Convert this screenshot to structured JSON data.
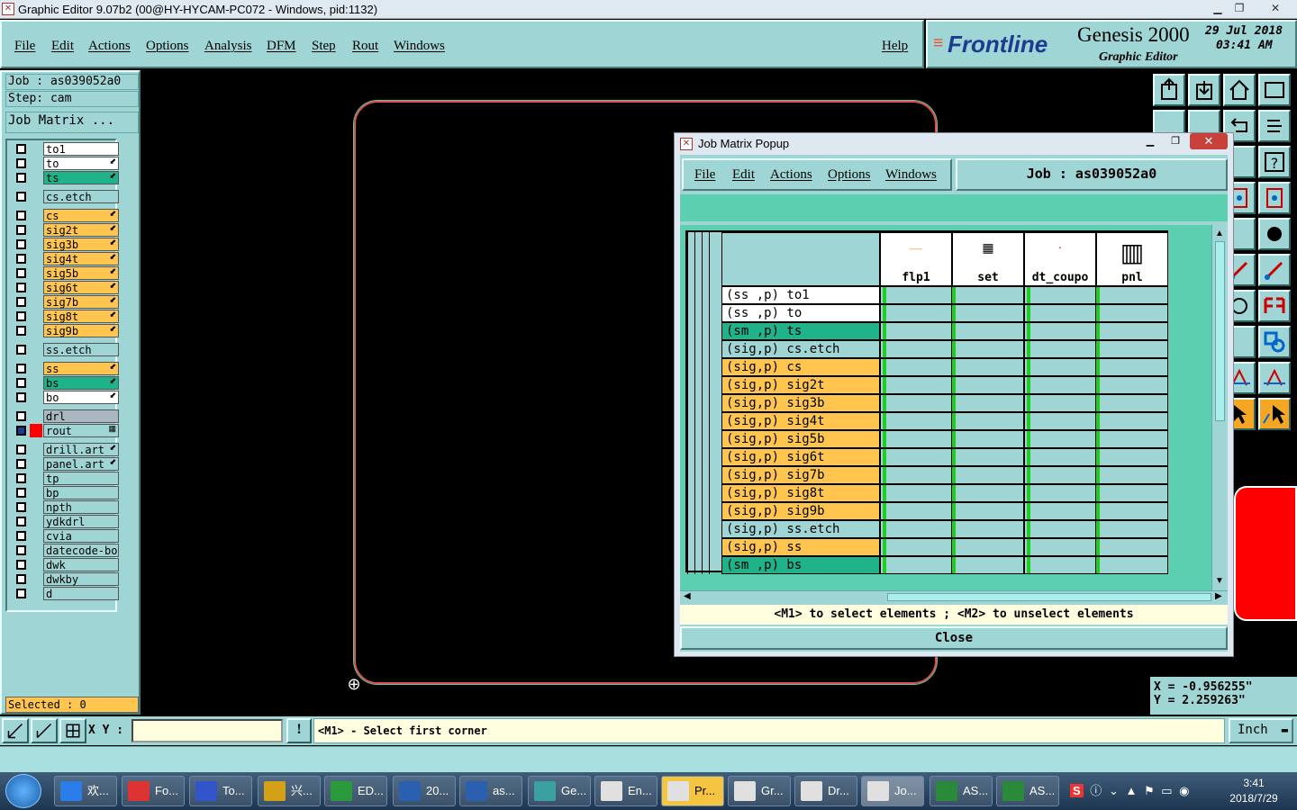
{
  "window": {
    "title": "Graphic Editor 9.07b2 (00@HY-HYCAM-PC072 - Windows, pid:1132)"
  },
  "menu": {
    "file": "File",
    "edit": "Edit",
    "actions": "Actions",
    "options": "Options",
    "analysis": "Analysis",
    "dfm": "DFM",
    "step": "Step",
    "rout": "Rout",
    "windows": "Windows",
    "help": "Help"
  },
  "brand": {
    "logo": "Frontline",
    "product": "Genesis 2000",
    "subtitle": "Graphic Editor",
    "date": "29 Jul 2018",
    "time": "03:41 AM"
  },
  "left": {
    "job": "Job : as039052a0",
    "step": "Step: cam",
    "job_matrix": "Job Matrix ...",
    "selected": "Selected : 0",
    "layers": [
      {
        "name": "to1",
        "color": "#ffffff",
        "mark": ""
      },
      {
        "name": "to",
        "color": "#ffffff",
        "mark": "⬋"
      },
      {
        "name": "ts",
        "color": "#20b38a",
        "mark": "⬋"
      },
      {
        "name": "cs.etch",
        "color": "#9fd5d5",
        "mark": ""
      },
      {
        "name": "cs",
        "color": "#ffc54f",
        "mark": "⬋"
      },
      {
        "name": "sig2t",
        "color": "#ffc54f",
        "mark": "⬋"
      },
      {
        "name": "sig3b",
        "color": "#ffc54f",
        "mark": "⬋"
      },
      {
        "name": "sig4t",
        "color": "#ffc54f",
        "mark": "⬋"
      },
      {
        "name": "sig5b",
        "color": "#ffc54f",
        "mark": "⬋"
      },
      {
        "name": "sig6t",
        "color": "#ffc54f",
        "mark": "⬋"
      },
      {
        "name": "sig7b",
        "color": "#ffc54f",
        "mark": "⬋"
      },
      {
        "name": "sig8t",
        "color": "#ffc54f",
        "mark": "⬋"
      },
      {
        "name": "sig9b",
        "color": "#ffc54f",
        "mark": "⬋"
      },
      {
        "name": "ss.etch",
        "color": "#9fd5d5",
        "mark": ""
      },
      {
        "name": "ss",
        "color": "#ffc54f",
        "mark": "⬋"
      },
      {
        "name": "bs",
        "color": "#20b38a",
        "mark": "⬋"
      },
      {
        "name": "bo",
        "color": "#ffffff",
        "mark": "⬋"
      },
      {
        "name": "drl",
        "color": "#a9b8c0",
        "mark": ""
      },
      {
        "name": "rout",
        "color": "#9fd5d5",
        "mark": "▦"
      },
      {
        "name": "drill.art",
        "color": "#9fd5d5",
        "mark": "⬋"
      },
      {
        "name": "panel.art",
        "color": "#9fd5d5",
        "mark": "⬋"
      },
      {
        "name": "tp",
        "color": "#9fd5d5",
        "mark": ""
      },
      {
        "name": "bp",
        "color": "#9fd5d5",
        "mark": ""
      },
      {
        "name": "npth",
        "color": "#9fd5d5",
        "mark": ""
      },
      {
        "name": "ydkdrl",
        "color": "#9fd5d5",
        "mark": ""
      },
      {
        "name": "cvia",
        "color": "#9fd5d5",
        "mark": ""
      },
      {
        "name": "datecode-bo",
        "color": "#9fd5d5",
        "mark": ""
      },
      {
        "name": "dwk",
        "color": "#9fd5d5",
        "mark": ""
      },
      {
        "name": "dwkby",
        "color": "#9fd5d5",
        "mark": ""
      },
      {
        "name": "d",
        "color": "#9fd5d5",
        "mark": ""
      }
    ]
  },
  "popup": {
    "title": "Job Matrix Popup",
    "menu": {
      "file": "File",
      "edit": "Edit",
      "actions": "Actions",
      "options": "Options",
      "windows": "Windows"
    },
    "job": "Job  :  as039052a0",
    "columns": [
      "flp1",
      "set",
      "dt_coupo",
      "pnl"
    ],
    "rows": [
      {
        "label": "(ss ,p) to1",
        "color": "#ffffff"
      },
      {
        "label": "(ss ,p) to",
        "color": "#ffffff"
      },
      {
        "label": "(sm ,p) ts",
        "color": "#20b38a"
      },
      {
        "label": "(sig,p) cs.etch",
        "color": "#9fd5d5"
      },
      {
        "label": "(sig,p) cs",
        "color": "#ffc54f"
      },
      {
        "label": "(sig,p) sig2t",
        "color": "#ffc54f"
      },
      {
        "label": "(sig,p) sig3b",
        "color": "#ffc54f"
      },
      {
        "label": "(sig,p) sig4t",
        "color": "#ffc54f"
      },
      {
        "label": "(sig,p) sig5b",
        "color": "#ffc54f"
      },
      {
        "label": "(sig,p) sig6t",
        "color": "#ffc54f"
      },
      {
        "label": "(sig,p) sig7b",
        "color": "#ffc54f"
      },
      {
        "label": "(sig,p) sig8t",
        "color": "#ffc54f"
      },
      {
        "label": "(sig,p) sig9b",
        "color": "#ffc54f"
      },
      {
        "label": "(sig,p) ss.etch",
        "color": "#9fd5d5"
      },
      {
        "label": "(sig,p) ss",
        "color": "#ffc54f"
      },
      {
        "label": "(sm ,p) bs",
        "color": "#20b38a"
      }
    ],
    "hint": "<M1> to select elements ; <M2> to unselect elements",
    "close": "Close"
  },
  "coords": {
    "x": "X = -0.956255\"",
    "y": "Y = 2.259263\""
  },
  "status": {
    "xy_label": "X Y :",
    "xy_value": "",
    "message": "<M1> - Select first corner",
    "units": "Inch"
  },
  "taskbar": {
    "items": [
      "欢...",
      "Fo...",
      "To...",
      "兴...",
      "ED...",
      "20...",
      "as...",
      "Ge...",
      "En...",
      "Pr...",
      "Gr...",
      "Dr...",
      "Jo...",
      "AS...",
      "AS..."
    ],
    "time": "3:41",
    "date": "2018/7/29"
  }
}
